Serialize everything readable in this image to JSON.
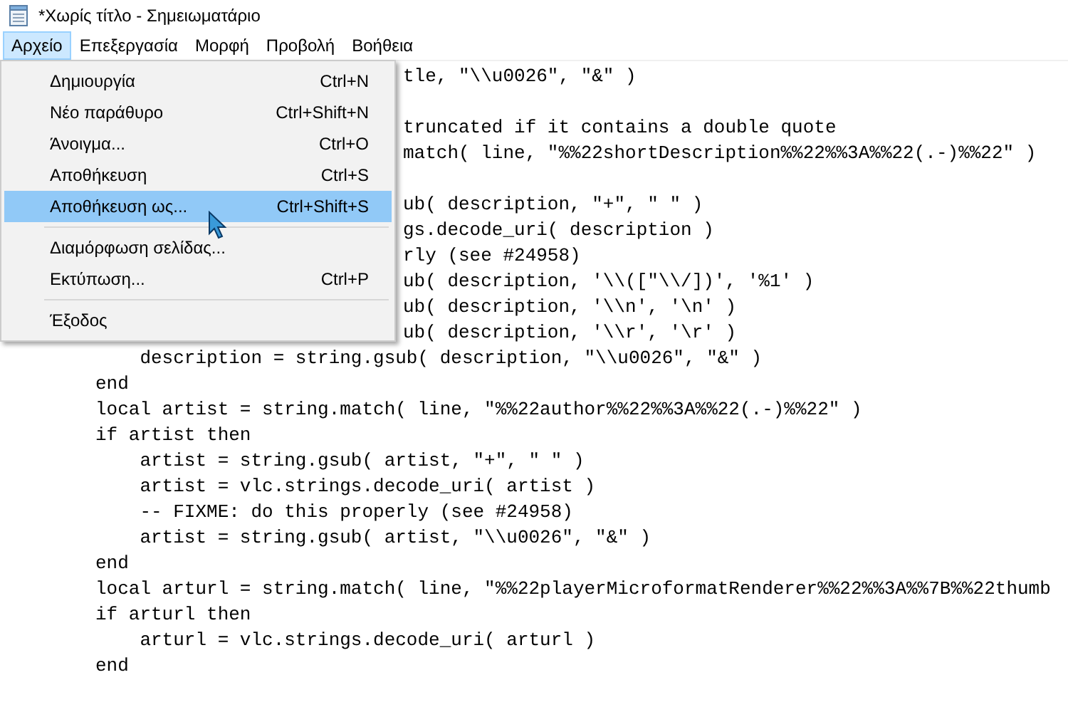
{
  "window": {
    "title": "*Χωρίς τίτλο - Σημειωματάριο"
  },
  "menu_bar": [
    {
      "label": "Αρχείο",
      "selected": true
    },
    {
      "label": "Επεξεργασία",
      "selected": false
    },
    {
      "label": "Μορφή",
      "selected": false
    },
    {
      "label": "Προβολή",
      "selected": false
    },
    {
      "label": "Βοήθεια",
      "selected": false
    }
  ],
  "file_menu": [
    {
      "kind": "item",
      "label": "Δημιουργία",
      "shortcut": "Ctrl+N",
      "selected": false
    },
    {
      "kind": "item",
      "label": "Νέο παράθυρο",
      "shortcut": "Ctrl+Shift+N",
      "selected": false
    },
    {
      "kind": "item",
      "label": "Άνοιγμα...",
      "shortcut": "Ctrl+O",
      "selected": false
    },
    {
      "kind": "item",
      "label": "Αποθήκευση",
      "shortcut": "Ctrl+S",
      "selected": false
    },
    {
      "kind": "item",
      "label": "Αποθήκευση ως...",
      "shortcut": "Ctrl+Shift+S",
      "selected": true
    },
    {
      "kind": "separator"
    },
    {
      "kind": "item",
      "label": "Διαμόρφωση σελίδας...",
      "selected": false
    },
    {
      "kind": "item",
      "label": "Εκτύπωση...",
      "shortcut": "Ctrl+P",
      "selected": false
    },
    {
      "kind": "separator"
    },
    {
      "kind": "item",
      "label": "Έξοδος",
      "selected": false
    }
  ],
  "editor": {
    "lines": [
      {
        "kind": "covered",
        "text": "tle, \"\\\\u0026\", \"&\" )"
      },
      {
        "kind": "blank"
      },
      {
        "kind": "covered",
        "text": "truncated if it contains a double quote"
      },
      {
        "kind": "covered",
        "text": "match( line, \"%%22shortDescription%%22%%3A%%22(.-)%%22\" )"
      },
      {
        "kind": "blank"
      },
      {
        "kind": "covered",
        "text": "ub( description, \"+\", \" \" )"
      },
      {
        "kind": "covered",
        "text": "gs.decode_uri( description )"
      },
      {
        "kind": "covered",
        "text": "rly (see #24958)"
      },
      {
        "kind": "covered",
        "text": "ub( description, '\\\\([\"\\\\/])', '%1' )"
      },
      {
        "kind": "covered",
        "text": "ub( description, '\\\\n', '\\n' )"
      },
      {
        "kind": "covered",
        "text": "ub( description, '\\\\r', '\\r' )"
      },
      {
        "kind": "code",
        "text": "    description = string.gsub( description, \"\\\\u0026\", \"&\" )"
      },
      {
        "kind": "code",
        "text": "end"
      },
      {
        "kind": "code",
        "text": "local artist = string.match( line, \"%%22author%%22%%3A%%22(.-)%%22\" )"
      },
      {
        "kind": "code",
        "text": "if artist then"
      },
      {
        "kind": "code",
        "text": "    artist = string.gsub( artist, \"+\", \" \" )"
      },
      {
        "kind": "code",
        "text": "    artist = vlc.strings.decode_uri( artist )"
      },
      {
        "kind": "code",
        "text": "    -- FIXME: do this properly (see #24958)"
      },
      {
        "kind": "code",
        "text": "    artist = string.gsub( artist, \"\\\\u0026\", \"&\" )"
      },
      {
        "kind": "code",
        "text": "end"
      },
      {
        "kind": "code",
        "text": "local arturl = string.match( line, \"%%22playerMicroformatRenderer%%22%%3A%%7B%%22thumb"
      },
      {
        "kind": "code",
        "text": "if arturl then"
      },
      {
        "kind": "code",
        "text": "    arturl = vlc.strings.decode_uri( arturl )"
      },
      {
        "kind": "code",
        "text": "end"
      }
    ]
  }
}
